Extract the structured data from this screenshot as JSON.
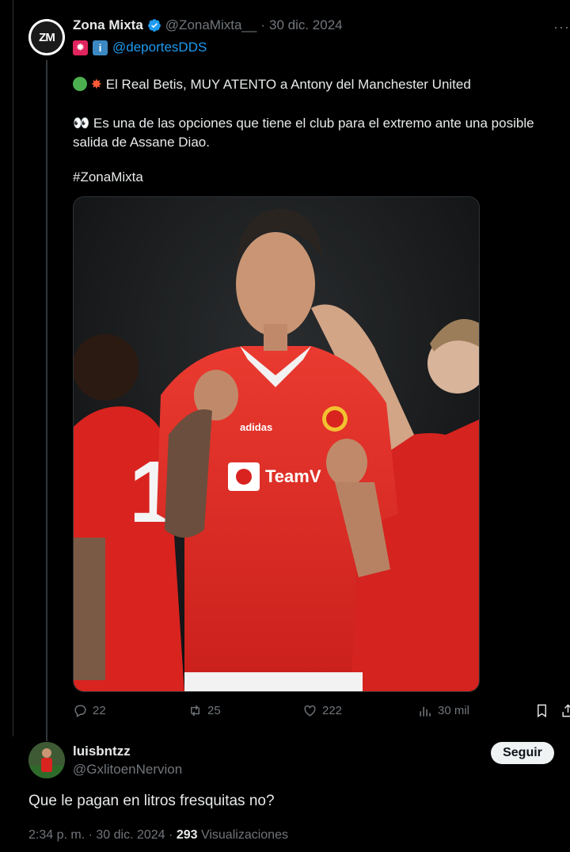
{
  "quoted_tweet": {
    "author_name": "Zona Mixta",
    "avatar_text": "ZM",
    "handle": "@ZonaMixta__",
    "separator": "·",
    "date": "30 dic. 2024",
    "more_label": "···",
    "sub_emojis": [
      "flag-emoji",
      "info-emoji"
    ],
    "sub_link": "@deportesDDS",
    "line1_text": "El  Real Betis, MUY ATENTO a Antony del Manchester United",
    "line2_text": "Es una de las opciones que tiene el club para el extremo ante una posible salida de Assane Diao.",
    "hashtag": "#ZonaMixta",
    "stats": {
      "replies": "22",
      "retweets": "25",
      "likes": "222",
      "views": "30 mil"
    }
  },
  "reply": {
    "author_name": "luisbntzz",
    "handle": "@GxlitoenNervion",
    "follow_label": "Seguir",
    "text": "Que le pagan en litros fresquitas no?",
    "time": "2:34 p. m.",
    "separator": "·",
    "date": "30 dic. 2024",
    "views_count": "293",
    "views_label": "Visualizaciones"
  },
  "colors": {
    "background": "#000000",
    "text": "#e7e9ea",
    "muted": "#71767b",
    "link": "#1d9bf0",
    "jersey_red": "#e02a24"
  }
}
